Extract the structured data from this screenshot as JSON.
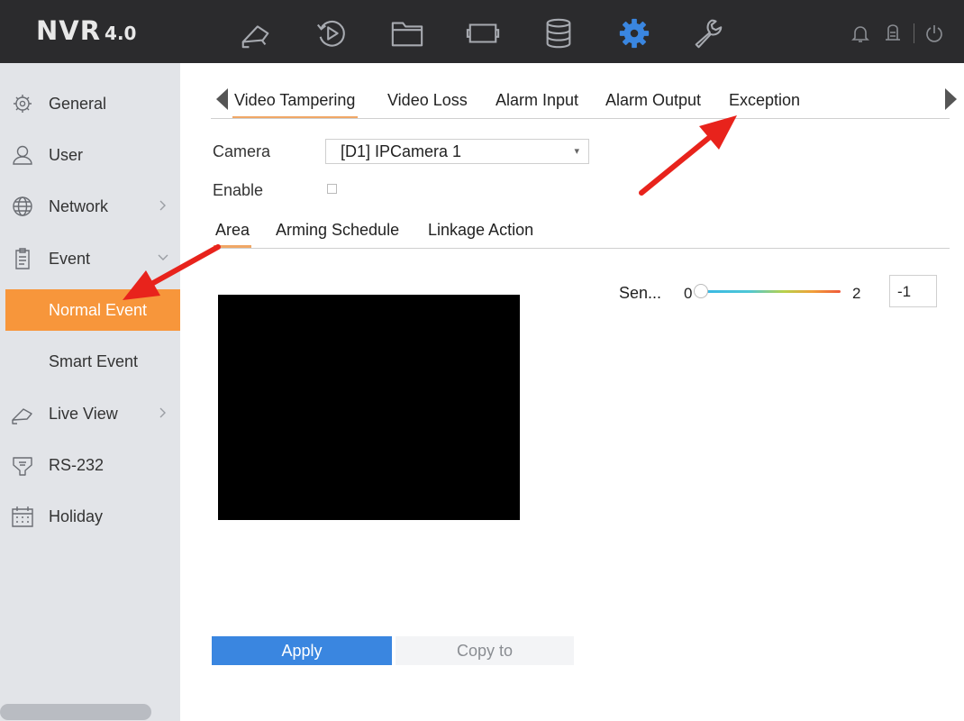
{
  "app": {
    "logo": "NVR",
    "version": "4.0"
  },
  "topbar": {
    "icons": [
      "live-view-icon",
      "playback-icon",
      "file-icon",
      "picture-icon",
      "storage-icon",
      "settings-gear-icon",
      "maintenance-wrench-icon"
    ],
    "active_icon": "settings-gear-icon",
    "accent": "#3a86e0",
    "right_icons": [
      "bell-icon",
      "lock-icon",
      "power-icon"
    ]
  },
  "sidebar": {
    "items": [
      {
        "label": "General",
        "icon": "gear-icon"
      },
      {
        "label": "User",
        "icon": "user-icon"
      },
      {
        "label": "Network",
        "icon": "globe-icon"
      },
      {
        "label": "Event",
        "icon": "clipboard-icon"
      },
      {
        "label": "Normal Event"
      },
      {
        "label": "Smart Event"
      },
      {
        "label": "Live View",
        "icon": "camera-icon"
      },
      {
        "label": "RS-232",
        "icon": "rs232-port-icon"
      },
      {
        "label": "Holiday",
        "icon": "calendar-icon"
      }
    ],
    "active_item": "Normal Event",
    "active_color": "#f7963b"
  },
  "tabs": {
    "items": [
      "Video Tampering",
      "Video Loss",
      "Alarm Input",
      "Alarm Output",
      "Exception"
    ],
    "active": "Video Tampering"
  },
  "form": {
    "camera_label": "Camera",
    "camera_value": "[D1] IPCamera 1",
    "enable_label": "Enable",
    "enable_checked": false
  },
  "subtabs": {
    "items": [
      "Area",
      "Arming Schedule",
      "Linkage Action"
    ],
    "active": "Area"
  },
  "sensitivity": {
    "label": "Sen...",
    "min": "0",
    "max": "2",
    "value": "-1",
    "position_fraction": 0
  },
  "buttons": {
    "apply": "Apply",
    "copy_to": "Copy to"
  },
  "annotation_color": "#e8231c"
}
